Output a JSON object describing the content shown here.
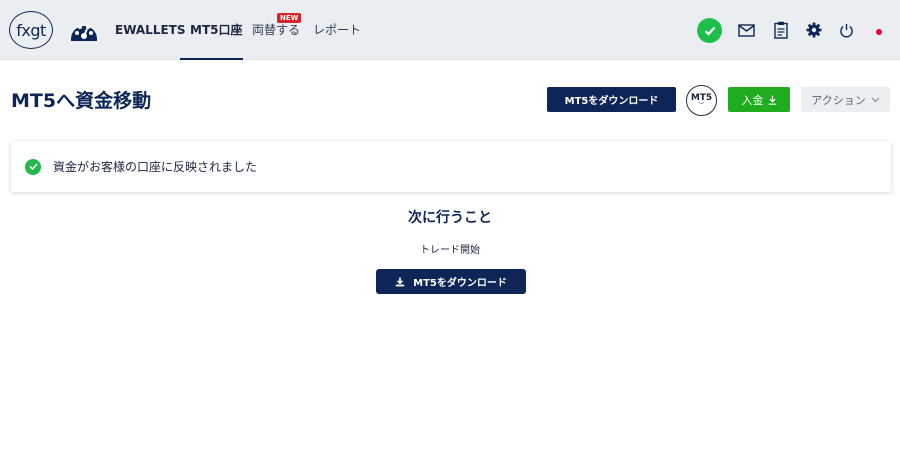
{
  "nav": {
    "logo_text": "fxgt",
    "items": [
      {
        "label": "EWALLETS"
      },
      {
        "label": "MT5口座"
      },
      {
        "label": "両替する",
        "badge": "NEW"
      },
      {
        "label": "レポート"
      }
    ],
    "active_item": "MT5口座",
    "icons": [
      "dashboard-gauge-icon",
      "status-check-icon",
      "mail-icon",
      "clipboard-icon",
      "gear-icon",
      "power-icon",
      "japan-flag-icon"
    ]
  },
  "header": {
    "title": "MT5へ資金移動",
    "download_button": "MT5をダウンロード",
    "mt5_badge": "MT5",
    "deposit_button": "入金",
    "action_button": "アクション"
  },
  "alert": {
    "message": "資金がお客様の口座に反映されました",
    "type": "success"
  },
  "next": {
    "title": "次に行うこと",
    "subtitle": "トレード開始",
    "button": "MT5をダウンロード"
  },
  "colors": {
    "navy": "#0e2557",
    "green": "#1fad1f",
    "success": "#22b84a",
    "nav_bg": "#ebeef1",
    "badge_red": "#d8232a"
  }
}
